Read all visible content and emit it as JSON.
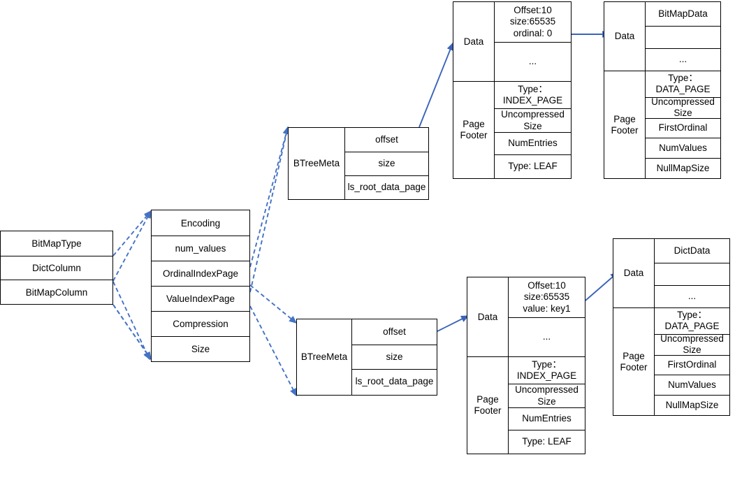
{
  "diagram": {
    "title": "Columnar page layout diagram",
    "colors": {
      "box_border": "#000000",
      "arrow_solid": "#3a63b8",
      "arrow_dashed": "#4472c4",
      "background": "#ffffff"
    },
    "column_meta": {
      "name": "column-meta-box",
      "rows": [
        "BitMapType",
        "DictColumn",
        "BitMapColumn"
      ]
    },
    "encoding_meta": {
      "name": "encoding-meta-box",
      "rows": [
        "Encoding",
        "num_values",
        "OrdinalIndexPage",
        "ValueIndexPage",
        "Compression",
        "Size"
      ]
    },
    "btree_meta_top": {
      "label": "BTreeMeta",
      "rows": [
        "offset",
        "size",
        "ls_root_data_page"
      ]
    },
    "btree_meta_bottom": {
      "label": "BTreeMeta",
      "rows": [
        "offset",
        "size",
        "ls_root_data_page"
      ]
    },
    "index_page_top": {
      "data_label": "Data",
      "footer_label": "Page\nFooter",
      "data_rows": [
        "Offset:10\nsize:65535\nordinal: 0",
        "..."
      ],
      "footer_rows": [
        "Type：\nINDEX_PAGE",
        "Uncompressed\nSize",
        "NumEntries",
        "Type: LEAF"
      ]
    },
    "index_page_bottom": {
      "data_label": "Data",
      "footer_label": "Page\nFooter",
      "data_rows": [
        "Offset:10\nsize:65535\nvalue: key1",
        "..."
      ],
      "footer_rows": [
        "Type：\nINDEX_PAGE",
        "Uncompressed\nSize",
        "NumEntries",
        "Type: LEAF"
      ]
    },
    "data_page_top": {
      "data_label": "Data",
      "footer_label": "Page\nFooter",
      "data_rows": [
        "BitMapData",
        "",
        "..."
      ],
      "footer_rows": [
        "Type：\nDATA_PAGE",
        "Uncompressed\nSize",
        "FirstOrdinal",
        "NumValues",
        "NullMapSize"
      ]
    },
    "data_page_bottom": {
      "data_label": "Data",
      "footer_label": "Page\nFooter",
      "data_rows": [
        "DictData",
        "",
        "..."
      ],
      "footer_rows": [
        "Type：\nDATA_PAGE",
        "Uncompressed\nSize",
        "FirstOrdinal",
        "NumValues",
        "NullMapSize"
      ]
    }
  }
}
